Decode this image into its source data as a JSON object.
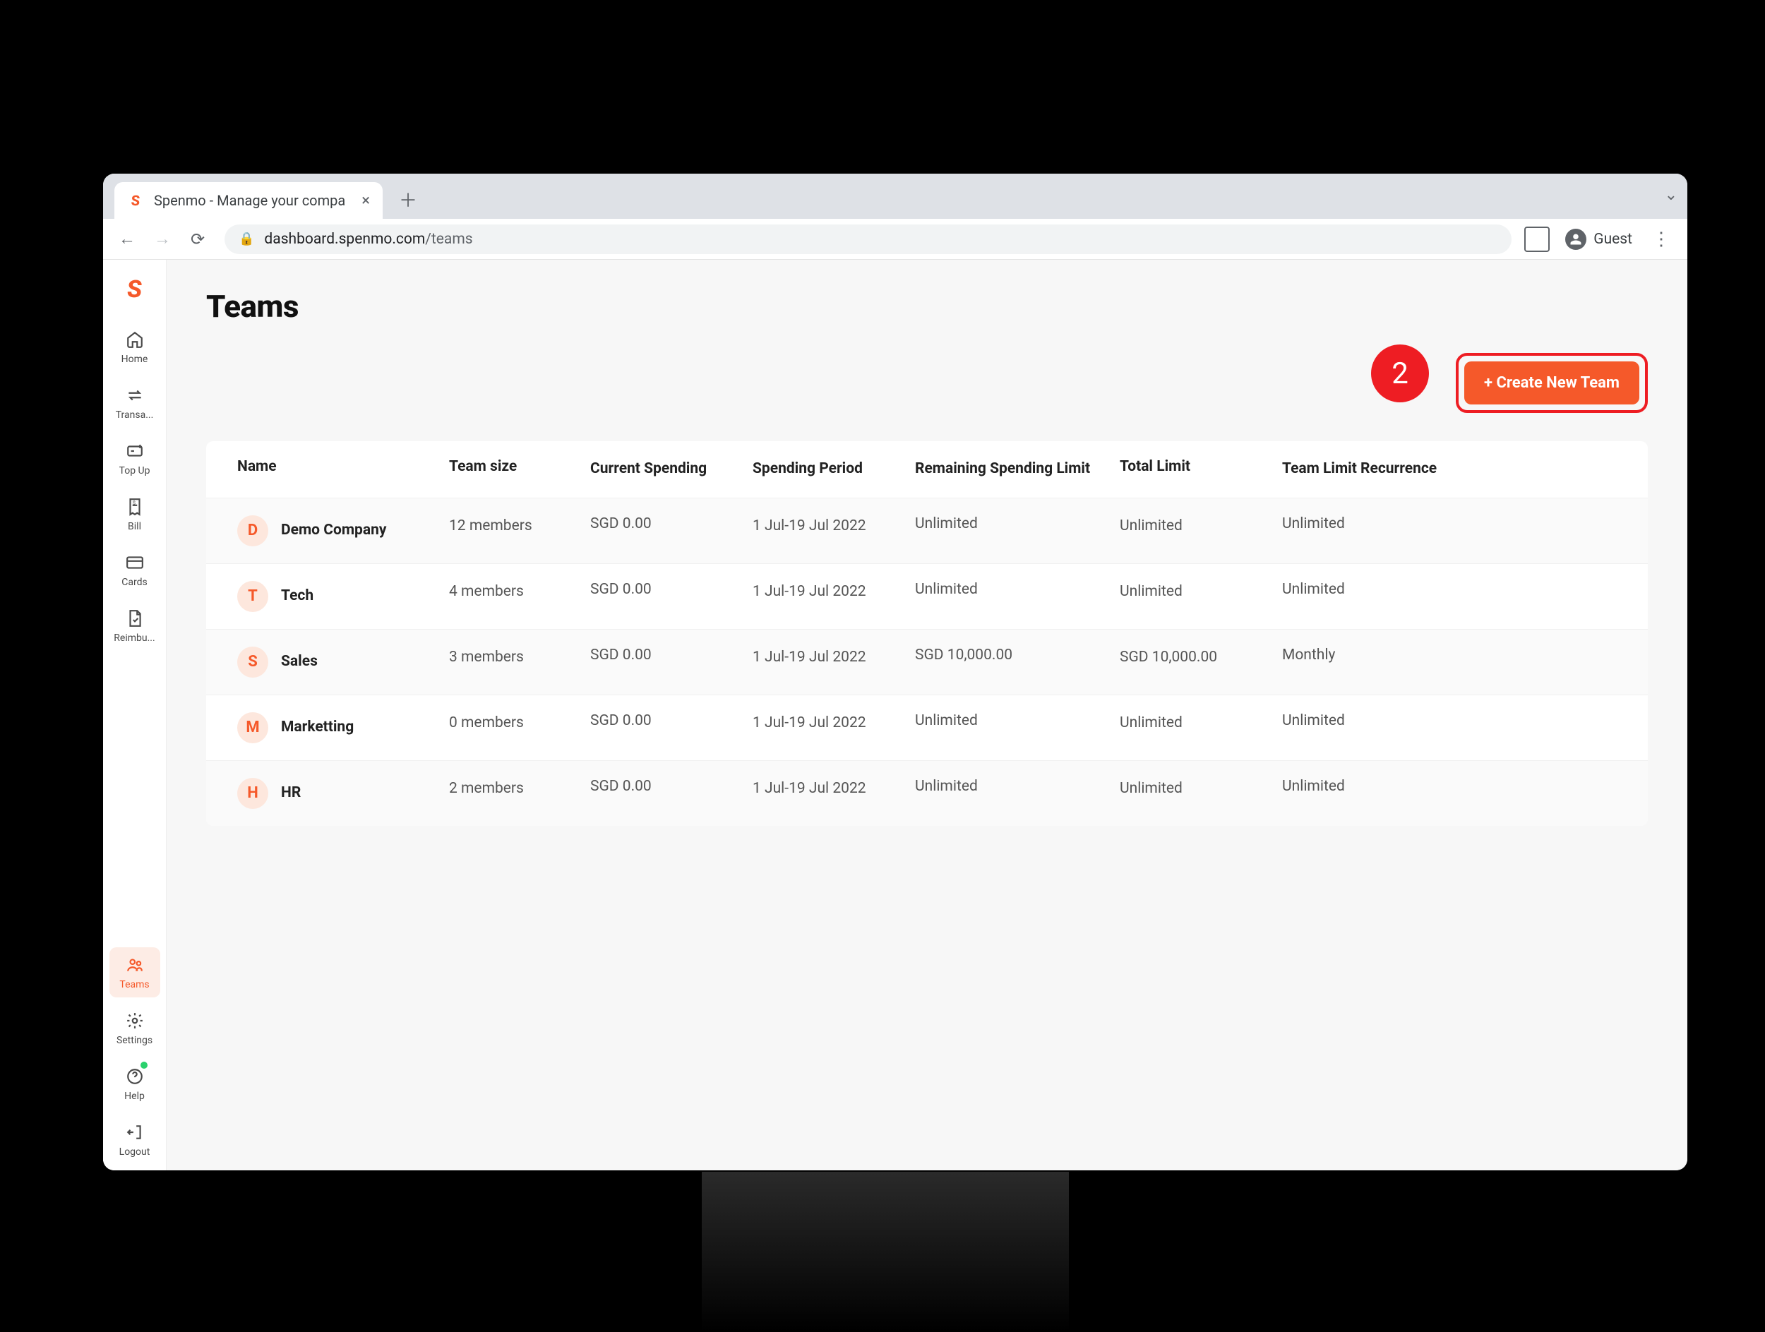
{
  "browser": {
    "tab_title": "Spenmo - Manage your compa",
    "url_host": "dashboard.spenmo.com",
    "url_path": "/teams",
    "guest_label": "Guest"
  },
  "sidebar": {
    "items": [
      {
        "label": "Home"
      },
      {
        "label": "Transa..."
      },
      {
        "label": "Top Up"
      },
      {
        "label": "Bill"
      },
      {
        "label": "Cards"
      },
      {
        "label": "Reimbu..."
      }
    ],
    "bottom": [
      {
        "label": "Teams"
      },
      {
        "label": "Settings"
      },
      {
        "label": "Help"
      },
      {
        "label": "Logout"
      }
    ]
  },
  "page": {
    "title": "Teams",
    "create_label": "+ Create New Team",
    "callout": "2"
  },
  "table": {
    "headers": [
      "Name",
      "Team size",
      "Current Spending",
      "Spending Period",
      "Remaining Spending Limit",
      "Total Limit",
      "Team Limit Recurrence"
    ],
    "rows": [
      {
        "initial": "D",
        "name": "Demo Company",
        "size": "12 members",
        "spending": "SGD 0.00",
        "period": "1 Jul-19 Jul 2022",
        "remaining": "Unlimited",
        "total": "Unlimited",
        "recurrence": "Unlimited"
      },
      {
        "initial": "T",
        "name": "Tech",
        "size": "4 members",
        "spending": "SGD 0.00",
        "period": "1 Jul-19 Jul 2022",
        "remaining": "Unlimited",
        "total": "Unlimited",
        "recurrence": "Unlimited"
      },
      {
        "initial": "S",
        "name": "Sales",
        "size": "3 members",
        "spending": "SGD 0.00",
        "period": "1 Jul-19 Jul 2022",
        "remaining": "SGD 10,000.00",
        "total": "SGD 10,000.00",
        "recurrence": "Monthly"
      },
      {
        "initial": "M",
        "name": "Marketting",
        "size": "0 members",
        "spending": "SGD 0.00",
        "period": "1 Jul-19 Jul 2022",
        "remaining": "Unlimited",
        "total": "Unlimited",
        "recurrence": "Unlimited"
      },
      {
        "initial": "H",
        "name": "HR",
        "size": "2 members",
        "spending": "SGD 0.00",
        "period": "1 Jul-19 Jul 2022",
        "remaining": "Unlimited",
        "total": "Unlimited",
        "recurrence": "Unlimited"
      }
    ]
  }
}
